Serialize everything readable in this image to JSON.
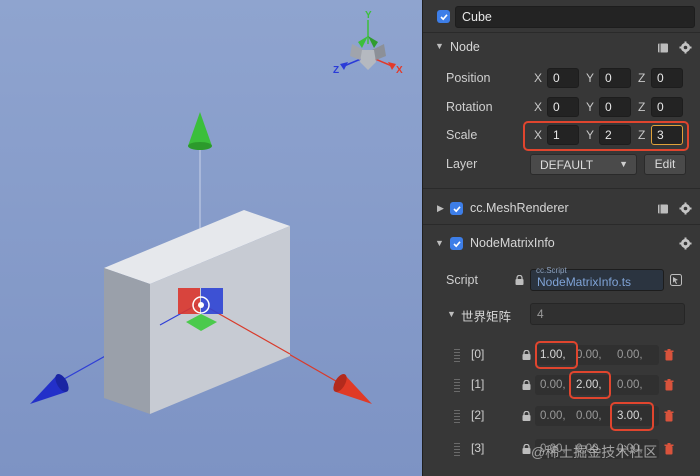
{
  "node_name": "Cube",
  "node_section": {
    "title": "Node",
    "position": {
      "label": "Position",
      "x": "0",
      "y": "0",
      "z": "0"
    },
    "rotation": {
      "label": "Rotation",
      "x": "0",
      "y": "0",
      "z": "0"
    },
    "scale": {
      "label": "Scale",
      "x": "1",
      "y": "2",
      "z": "3"
    },
    "layer": {
      "label": "Layer",
      "value": "DEFAULT",
      "edit_label": "Edit"
    }
  },
  "axis_letters": {
    "x": "X",
    "y": "Y",
    "z": "Z"
  },
  "mesh_renderer": {
    "title": "cc.MeshRenderer"
  },
  "matrix_info": {
    "title": "NodeMatrixInfo",
    "script_label": "Script",
    "script_type": "cc.Script",
    "script_value": "NodeMatrixInfo.ts",
    "world_matrix_label": "世界矩阵",
    "world_matrix_count": "4",
    "rows": [
      {
        "index": "[0]",
        "values": [
          "1.00,",
          "0.00,",
          "0.00,"
        ]
      },
      {
        "index": "[1]",
        "values": [
          "0.00,",
          "2.00,",
          "0.00,"
        ]
      },
      {
        "index": "[2]",
        "values": [
          "0.00,",
          "0.00,",
          "3.00,"
        ]
      },
      {
        "index": "[3]",
        "values": [
          "0.00,",
          "0.00,",
          "0.00,"
        ]
      }
    ]
  },
  "gizmo": {
    "x": "X",
    "y": "Y",
    "z": "Z"
  },
  "watermark": "@稀土掘金技术社区",
  "colors": {
    "accent": "#3d7ee8",
    "highlight": "#e0452e",
    "x_axis": "#e23a2a",
    "y_axis": "#3bbf3b",
    "z_axis": "#2a3bd8"
  }
}
